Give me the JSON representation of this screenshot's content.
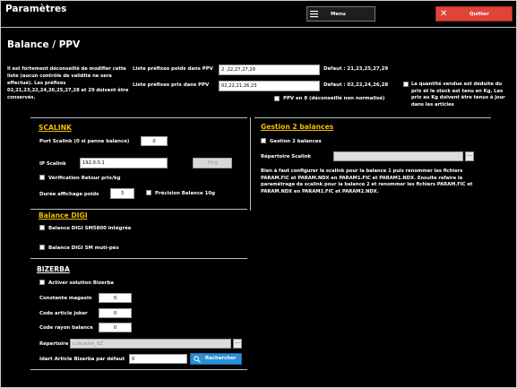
{
  "window": {
    "title": "Paramètres"
  },
  "toolbar": {
    "menu_label": "Menu",
    "quit_label": "Quitter"
  },
  "page": {
    "title": "Balance / PPV",
    "warning": "Il est fortement déconseillé de modifier cette liste (aucun contrôle de validité ne sera effectué). Les préfixes 02,21,23,22,24,26,25,27,28 et 29 doivent être conservés."
  },
  "prefixes": {
    "weight_label": "Liste préfixes poids dans PPV",
    "weight_value": "2  ,22,27,27,29",
    "weight_default": "Défaut : 21,23,25,27,29",
    "price_label": "Liste préfixes prix dans PPV",
    "price_value": "02,22,21,26,23",
    "price_default": "Défaut : 02,22,24,26,28",
    "ppv_ean8_label": "PPV en 8 (déconseillé non normalisé)",
    "qty_note": "La quantité vendue est déduite du prix et le stock est tenu en Kg. Les prix au Kg doivent être tenus à jour dans les articles"
  },
  "scalink": {
    "title": "SCALINK",
    "port_label": "Port Scalink (0 si panne balance)",
    "port_value": "0",
    "ip_label": "IP Scalink",
    "ip_value": "192.0.0.1",
    "ping_label": "Ping",
    "verif_label": "Vérification Retour prix/kg",
    "duree_label": "Durée affichage poids",
    "duree_value": "3",
    "precision_label": "Précision Balance 10g"
  },
  "gestion2": {
    "title": "Gestion 2 balances",
    "checkbox_label": "Gestion 2 balances",
    "dir_label": "Répertoire Scalink",
    "dir_value": "",
    "dots": "...",
    "note": "Bien à faut configurer le scalink pour la balance 1 puis renommer les fichiers PARAM.FIC et PARAM.NDX en PARAM1.FIC et PARAM1.NDX. Ensuite refaire le paramétrage de scalink pour la balance 2 et renommer les fichiers PARAM.FIC et PARAM.NDX en PARAM2.FIC et PARAM2.NDX."
  },
  "digi": {
    "title": "Balance DIGI",
    "sm5800_label": "Balance DIGI SM5800 intégrée",
    "sm300_label": "Balance DIGI SM muti-pés"
  },
  "bizerba": {
    "title": "BIZERBA",
    "activate_label": "Activer solution Bizerba",
    "magasin_label": "Constante magasin",
    "magasin_value": "0",
    "joker_label": "Code article joker",
    "joker_value": "0",
    "rayon_label": "Code rayon balance",
    "rayon_value": "0",
    "dir_label": "Répertoire",
    "dir_value": "c:\\scalink_VZ",
    "dots": "...",
    "start_label": "Idart Article Bizerba par défaut",
    "start_value": "0",
    "search_label": "Rechercher"
  }
}
